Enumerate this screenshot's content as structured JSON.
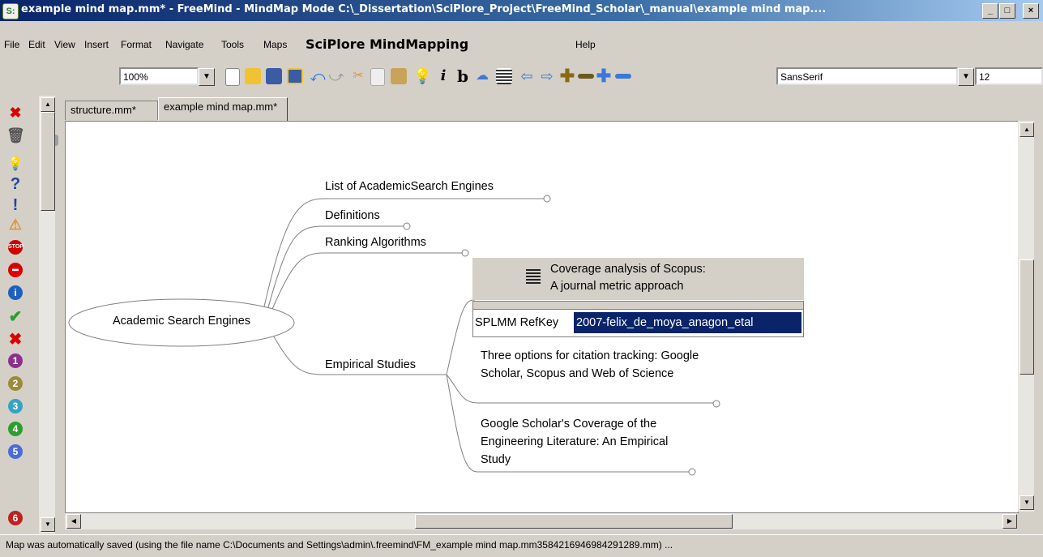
{
  "window": {
    "app_icon": "S:",
    "title": "example mind map.mm* - FreeMind - MindMap Mode C:\\_Dissertation\\SciPlore_Project\\FreeMind_Scholar\\_manual\\example mind map....",
    "controls": [
      "_",
      "□",
      "×"
    ]
  },
  "menu": [
    "File",
    "Edit",
    "View",
    "Insert",
    "Format",
    "Navigate",
    "Tools",
    "Maps",
    "SciPlore MindMapping",
    "Help"
  ],
  "toolbar": {
    "zoom": "100%",
    "font_family": "SansSerif",
    "font_size": "12",
    "icons": [
      "back-icon",
      "forward-icon",
      "print-icon",
      "filter-icon",
      "new-icon",
      "open-icon",
      "save-icon",
      "save-as-icon",
      "undo-icon",
      "redo-icon",
      "cut-icon",
      "copy-icon",
      "paste-icon",
      "idea-icon",
      "italic-icon",
      "bold-icon",
      "cloud-icon",
      "attributes-icon",
      "left-arrow-icon",
      "right-arrow-icon",
      "plus-icon",
      "minus-icon",
      "blue-plus-icon",
      "blue-minus-icon"
    ]
  },
  "left_icons": [
    "remove-last-icon",
    "remove-all-icon",
    "idea-icon",
    "question-icon",
    "important-icon",
    "warning-icon",
    "stop-icon",
    "stop-sign-icon",
    "info-icon",
    "check-icon",
    "cross-icon",
    "priority-1-icon",
    "priority-2-icon",
    "priority-3-icon",
    "priority-4-icon",
    "priority-5-icon",
    "priority-6-icon"
  ],
  "tabs": [
    "structure.mm*",
    "example mind map.mm*"
  ],
  "mindmap": {
    "root": "Academic Search Engines",
    "children": [
      "List of AcademicSearch Engines",
      "Definitions",
      "Ranking Algorithms",
      "Empirical Studies"
    ],
    "studies": [
      {
        "title_line1": "Coverage analysis of Scopus:",
        "title_line2": "A journal metric approach",
        "attr_key": "SPLMM RefKey",
        "attr_value": "2007-felix_de_moya_anagon_etal"
      },
      {
        "title": "Three options for citation tracking: Google Scholar, Scopus and Web of Science"
      },
      {
        "title": "Google Scholar's Coverage of the Engineering Literature: An Empirical Study"
      }
    ]
  },
  "status": "Map was automatically saved (using the file name C:\\Documents and Settings\\admin\\.freemind\\FM_example mind map.mm3584216946984291289.mm) ..."
}
